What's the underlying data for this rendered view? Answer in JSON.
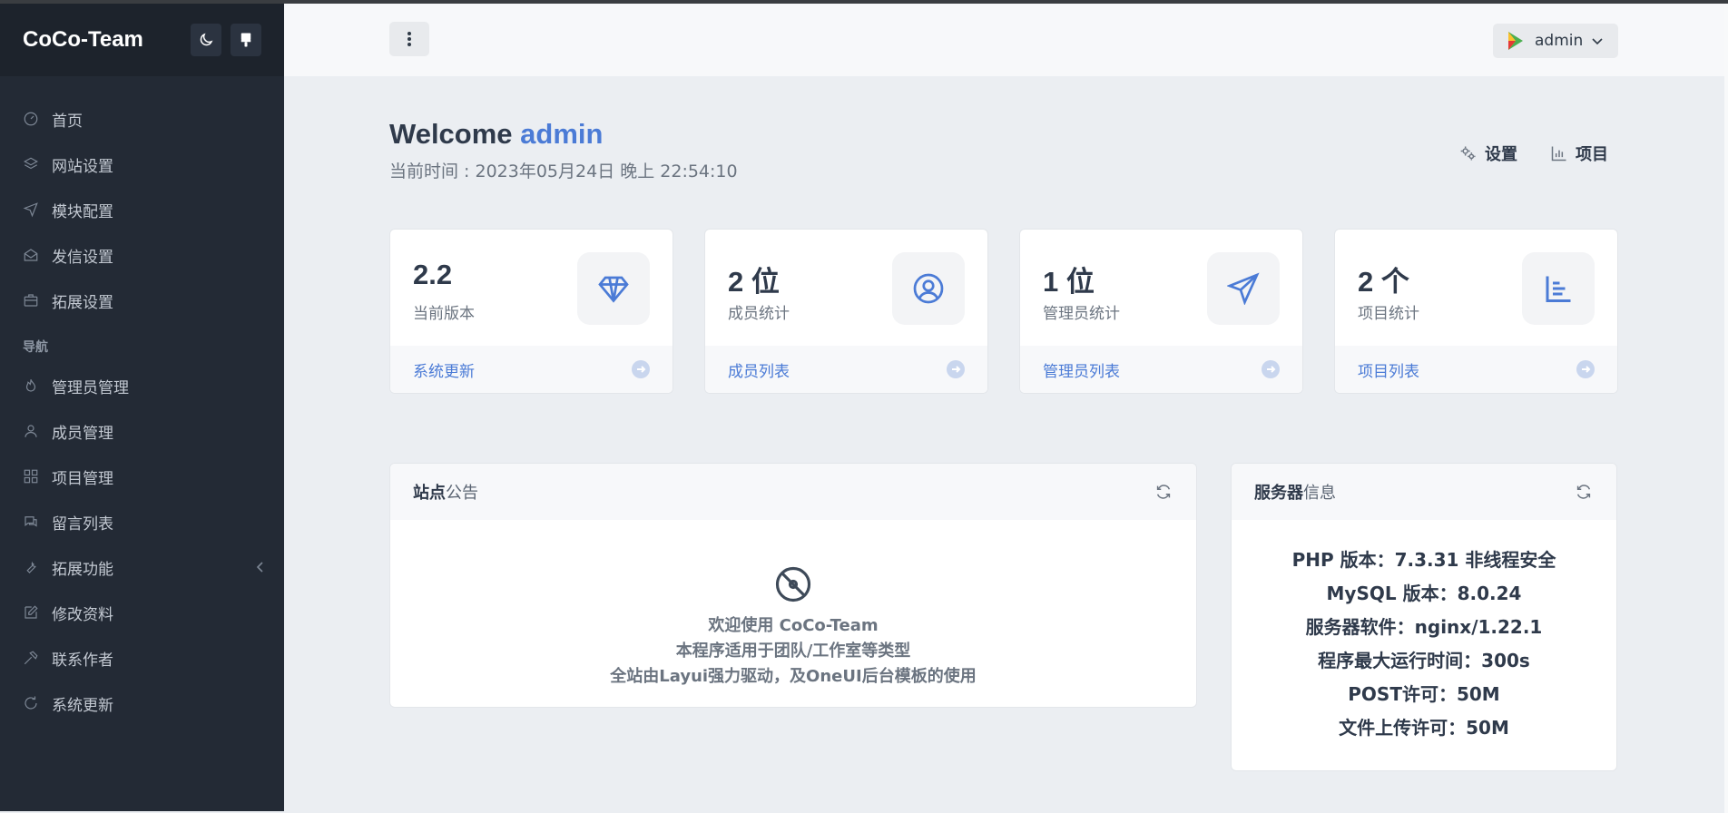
{
  "sidebar": {
    "brand": "CoCo-Team",
    "items_main": [
      {
        "label": "首页",
        "icon": "dashboard-icon"
      },
      {
        "label": "网站设置",
        "icon": "layers-icon"
      },
      {
        "label": "模块配置",
        "icon": "send-icon"
      },
      {
        "label": "发信设置",
        "icon": "mail-open-icon"
      },
      {
        "label": "拓展设置",
        "icon": "toolbox-icon"
      }
    ],
    "nav_heading": "导航",
    "items_nav": [
      {
        "label": "管理员管理",
        "icon": "fire-icon"
      },
      {
        "label": "成员管理",
        "icon": "user-icon"
      },
      {
        "label": "项目管理",
        "icon": "grid-icon"
      },
      {
        "label": "留言列表",
        "icon": "comments-icon"
      },
      {
        "label": "拓展功能",
        "icon": "wrench-icon"
      },
      {
        "label": "修改资料",
        "icon": "edit-icon"
      },
      {
        "label": "联系作者",
        "icon": "hammer-icon"
      },
      {
        "label": "系统更新",
        "icon": "refresh-icon"
      }
    ]
  },
  "header": {
    "username": "admin"
  },
  "welcome": {
    "prefix": "Welcome",
    "username": "admin",
    "time": "当前时间 : 2023年05月24日 晚上 22:54:10",
    "quick_settings": "设置",
    "quick_projects": "项目"
  },
  "stats": [
    {
      "value": "2.2",
      "label": "当前版本",
      "link": "系统更新",
      "icon": "diamond-icon"
    },
    {
      "value": "2 位",
      "label": "成员统计",
      "link": "成员列表",
      "icon": "user-circle-icon"
    },
    {
      "value": "1 位",
      "label": "管理员统计",
      "link": "管理员列表",
      "icon": "paper-plane-icon"
    },
    {
      "value": "2 个",
      "label": "项目统计",
      "link": "项目列表",
      "icon": "chart-bar-icon"
    }
  ],
  "notice": {
    "title_bold": "站点",
    "title_rest": "公告",
    "lines": [
      "欢迎使用 CoCo-Team",
      "本程序适用于团队/工作室等类型",
      "全站由Layui强力驱动，及OneUI后台模板的使用"
    ]
  },
  "server": {
    "title_bold": "服务器",
    "title_rest": "信息",
    "lines": [
      "PHP 版本：7.3.31 非线程安全",
      "MySQL 版本：8.0.24",
      "服务器软件：nginx/1.22.1",
      "程序最大运行时间：300s",
      "POST许可：50M",
      "文件上传许可：50M"
    ]
  },
  "colors": {
    "sidebar_bg": "#232a35",
    "accent": "#4b7bd6",
    "page_bg": "#ebeef2"
  }
}
